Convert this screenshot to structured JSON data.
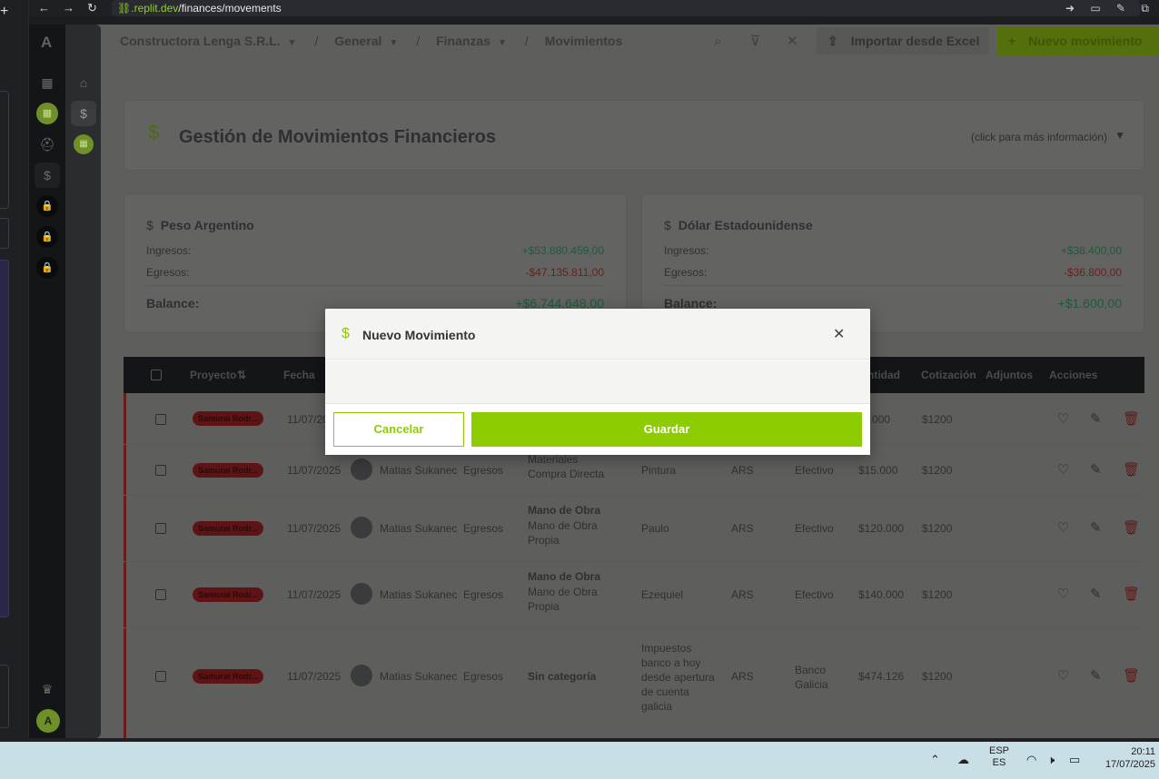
{
  "browser": {
    "new_tab": "+",
    "back": "←",
    "forward": "→",
    "reload": "↻",
    "url_domain": ".replit.dev",
    "url_path": "/finances/movements",
    "tools": "➜ ▭ ✎ ⧉"
  },
  "rail": {
    "logo": "A",
    "avatar": "A"
  },
  "breadcrumb": {
    "company": "Constructora Lenga S.R.L.",
    "section": "General",
    "module": "Finanzas",
    "page": "Movimientos"
  },
  "header": {
    "import_label": "Importar desde Excel",
    "new_label": "Nuevo movimiento"
  },
  "title_card": {
    "title": "Gestión de Movimientos Financieros",
    "more_info": "(click para más información)"
  },
  "currencies": [
    {
      "name": "Peso Argentino",
      "income_label": "Ingresos:",
      "income": "+$53.880.459,00",
      "expense_label": "Egresos:",
      "expense": "-$47.135.811,00",
      "balance_label": "Balance:",
      "balance": "+$6.744.648,00"
    },
    {
      "name": "Dólar Estadounidense",
      "income_label": "Ingresos:",
      "income": "+$38.400,00",
      "expense_label": "Egresos:",
      "expense": "-$36.800,00",
      "balance_label": "Balance:",
      "balance": "+$1.600,00"
    }
  ],
  "table": {
    "headers": {
      "project": "Proyecto",
      "date": "Fecha",
      "amount": "ntidad",
      "rate": "Cotización",
      "attachments": "Adjuntos",
      "actions": "Acciones"
    },
    "rows": [
      {
        "project": "Samurai Rodr...",
        "date": "11/07/2025",
        "user": "",
        "type": "",
        "category": "",
        "subcategory": "",
        "detail": "",
        "currency": "",
        "wallet": "",
        "amount": "$100.000",
        "rate": "$1200"
      },
      {
        "project": "Samurai Rodr...",
        "date": "11/07/2025",
        "user": "Matias Sukanec",
        "type": "Egresos",
        "category": "Materiales",
        "subcategory": "Compra Directa",
        "detail": "Pintura",
        "currency": "ARS",
        "wallet": "Efectivo",
        "amount": "$15.000",
        "rate": "$1200"
      },
      {
        "project": "Samurai Rodr...",
        "date": "11/07/2025",
        "user": "Matias Sukanec",
        "type": "Egresos",
        "category": "Mano de Obra",
        "subcategory": "Mano de Obra Propia",
        "detail": "Paulo",
        "currency": "ARS",
        "wallet": "Efectivo",
        "amount": "$120.000",
        "rate": "$1200"
      },
      {
        "project": "Samurai Rodr...",
        "date": "11/07/2025",
        "user": "Matias Sukanec",
        "type": "Egresos",
        "category": "Mano de Obra",
        "subcategory": "Mano de Obra Propia",
        "detail": "Ezequiel",
        "currency": "ARS",
        "wallet": "Efectivo",
        "amount": "$140.000",
        "rate": "$1200"
      },
      {
        "project": "Samurai Rodr...",
        "date": "11/07/2025",
        "user": "Matias Sukanec",
        "type": "Egresos",
        "category": "Sin categoría",
        "subcategory": "",
        "detail": "Impuestos banco a hoy desde apertura de cuenta galicia",
        "currency": "ARS",
        "wallet": "Banco Galicia",
        "amount": "$474.126",
        "rate": "$1200"
      }
    ]
  },
  "modal": {
    "title": "Nuevo Movimiento",
    "cancel_label": "Cancelar",
    "save_label": "Guardar",
    "accent": "#8ccc00"
  },
  "taskbar": {
    "lang_1": "ESP",
    "lang_2": "ES",
    "time": "20:11",
    "date": "17/07/2025"
  }
}
